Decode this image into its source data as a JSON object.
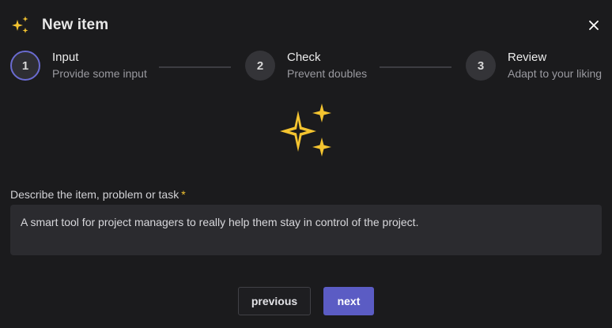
{
  "dialog": {
    "title": "New item",
    "header_icon": "sparkles-icon",
    "close_icon": "close-icon"
  },
  "steps": [
    {
      "number": "1",
      "title": "Input",
      "subtitle": "Provide some input",
      "active": true
    },
    {
      "number": "2",
      "title": "Check",
      "subtitle": "Prevent doubles",
      "active": false
    },
    {
      "number": "3",
      "title": "Review",
      "subtitle": "Adapt to your liking",
      "active": false
    }
  ],
  "form": {
    "label": "Describe the item, problem or task",
    "required_mark": "*",
    "value": "A smart tool for project managers to really help them stay in control of the project."
  },
  "buttons": {
    "previous": "previous",
    "next": "next"
  },
  "colors": {
    "accent": "#5b5cc4",
    "sparkle": "#f4c430",
    "background": "#1b1b1d"
  }
}
